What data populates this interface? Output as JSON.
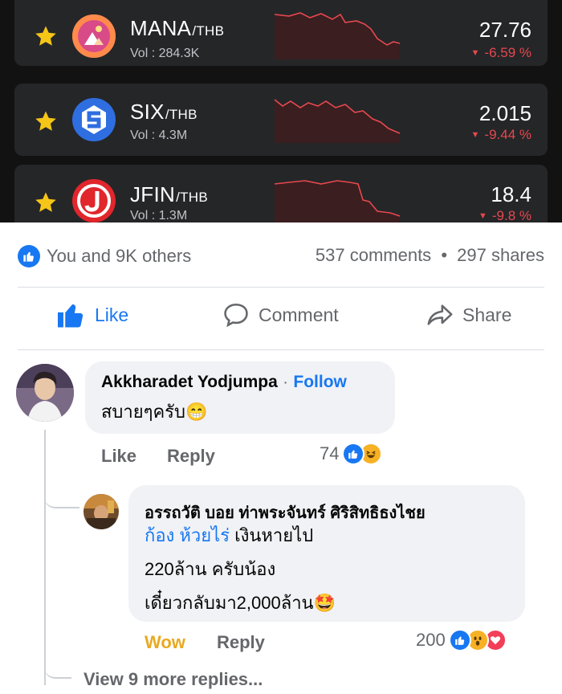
{
  "market": {
    "rows": [
      {
        "symbol": "MANA",
        "quote": "/THB",
        "volume": "Vol : 284.3K",
        "price": "27.76",
        "change": "-6.59 %",
        "coin_color": "#f2775a",
        "icon": "mana-coin-icon"
      },
      {
        "symbol": "SIX",
        "quote": "/THB",
        "volume": "Vol : 4.3M",
        "price": "2.015",
        "change": "-9.44 %",
        "coin_color": "#3b6fd6",
        "icon": "six-coin-icon"
      },
      {
        "symbol": "JFIN",
        "quote": "/THB",
        "volume": "Vol : 1.3M",
        "price": "18.4",
        "change": "-9.8 %",
        "coin_color": "#e1262c",
        "icon": "jfin-coin-icon"
      }
    ],
    "star_color": "#f5c518",
    "down_color": "#e6484e"
  },
  "post": {
    "reactions_text": "You and 9K others",
    "comments_count": "537 comments",
    "separator": "•",
    "shares_count": "297 shares",
    "actions": {
      "like": "Like",
      "comment": "Comment",
      "share": "Share"
    }
  },
  "comments": [
    {
      "author": "Akkharadet Yodjumpa",
      "follow_sep": "·",
      "follow": "Follow",
      "text": "สบายๆครับ",
      "emoji": "😁",
      "like_label": "Like",
      "reply_label": "Reply",
      "reaction_count": "74"
    }
  ],
  "reply": {
    "author": "อรรถวัติ บอย ท่าพระจันทร์ ศิริสิทธิธงไชย",
    "tag": "ก้อง ห้วยไร่",
    "line1_rest": " เงินหายไป",
    "line2": "220ล้าน ครับน้อง",
    "line3": "เดี๋ยวกลับมา2,000ล้าน",
    "emoji": "🤩",
    "reaction_label": "Wow",
    "reply_label": "Reply",
    "reaction_count": "200"
  },
  "view_more": "View 9 more replies..."
}
